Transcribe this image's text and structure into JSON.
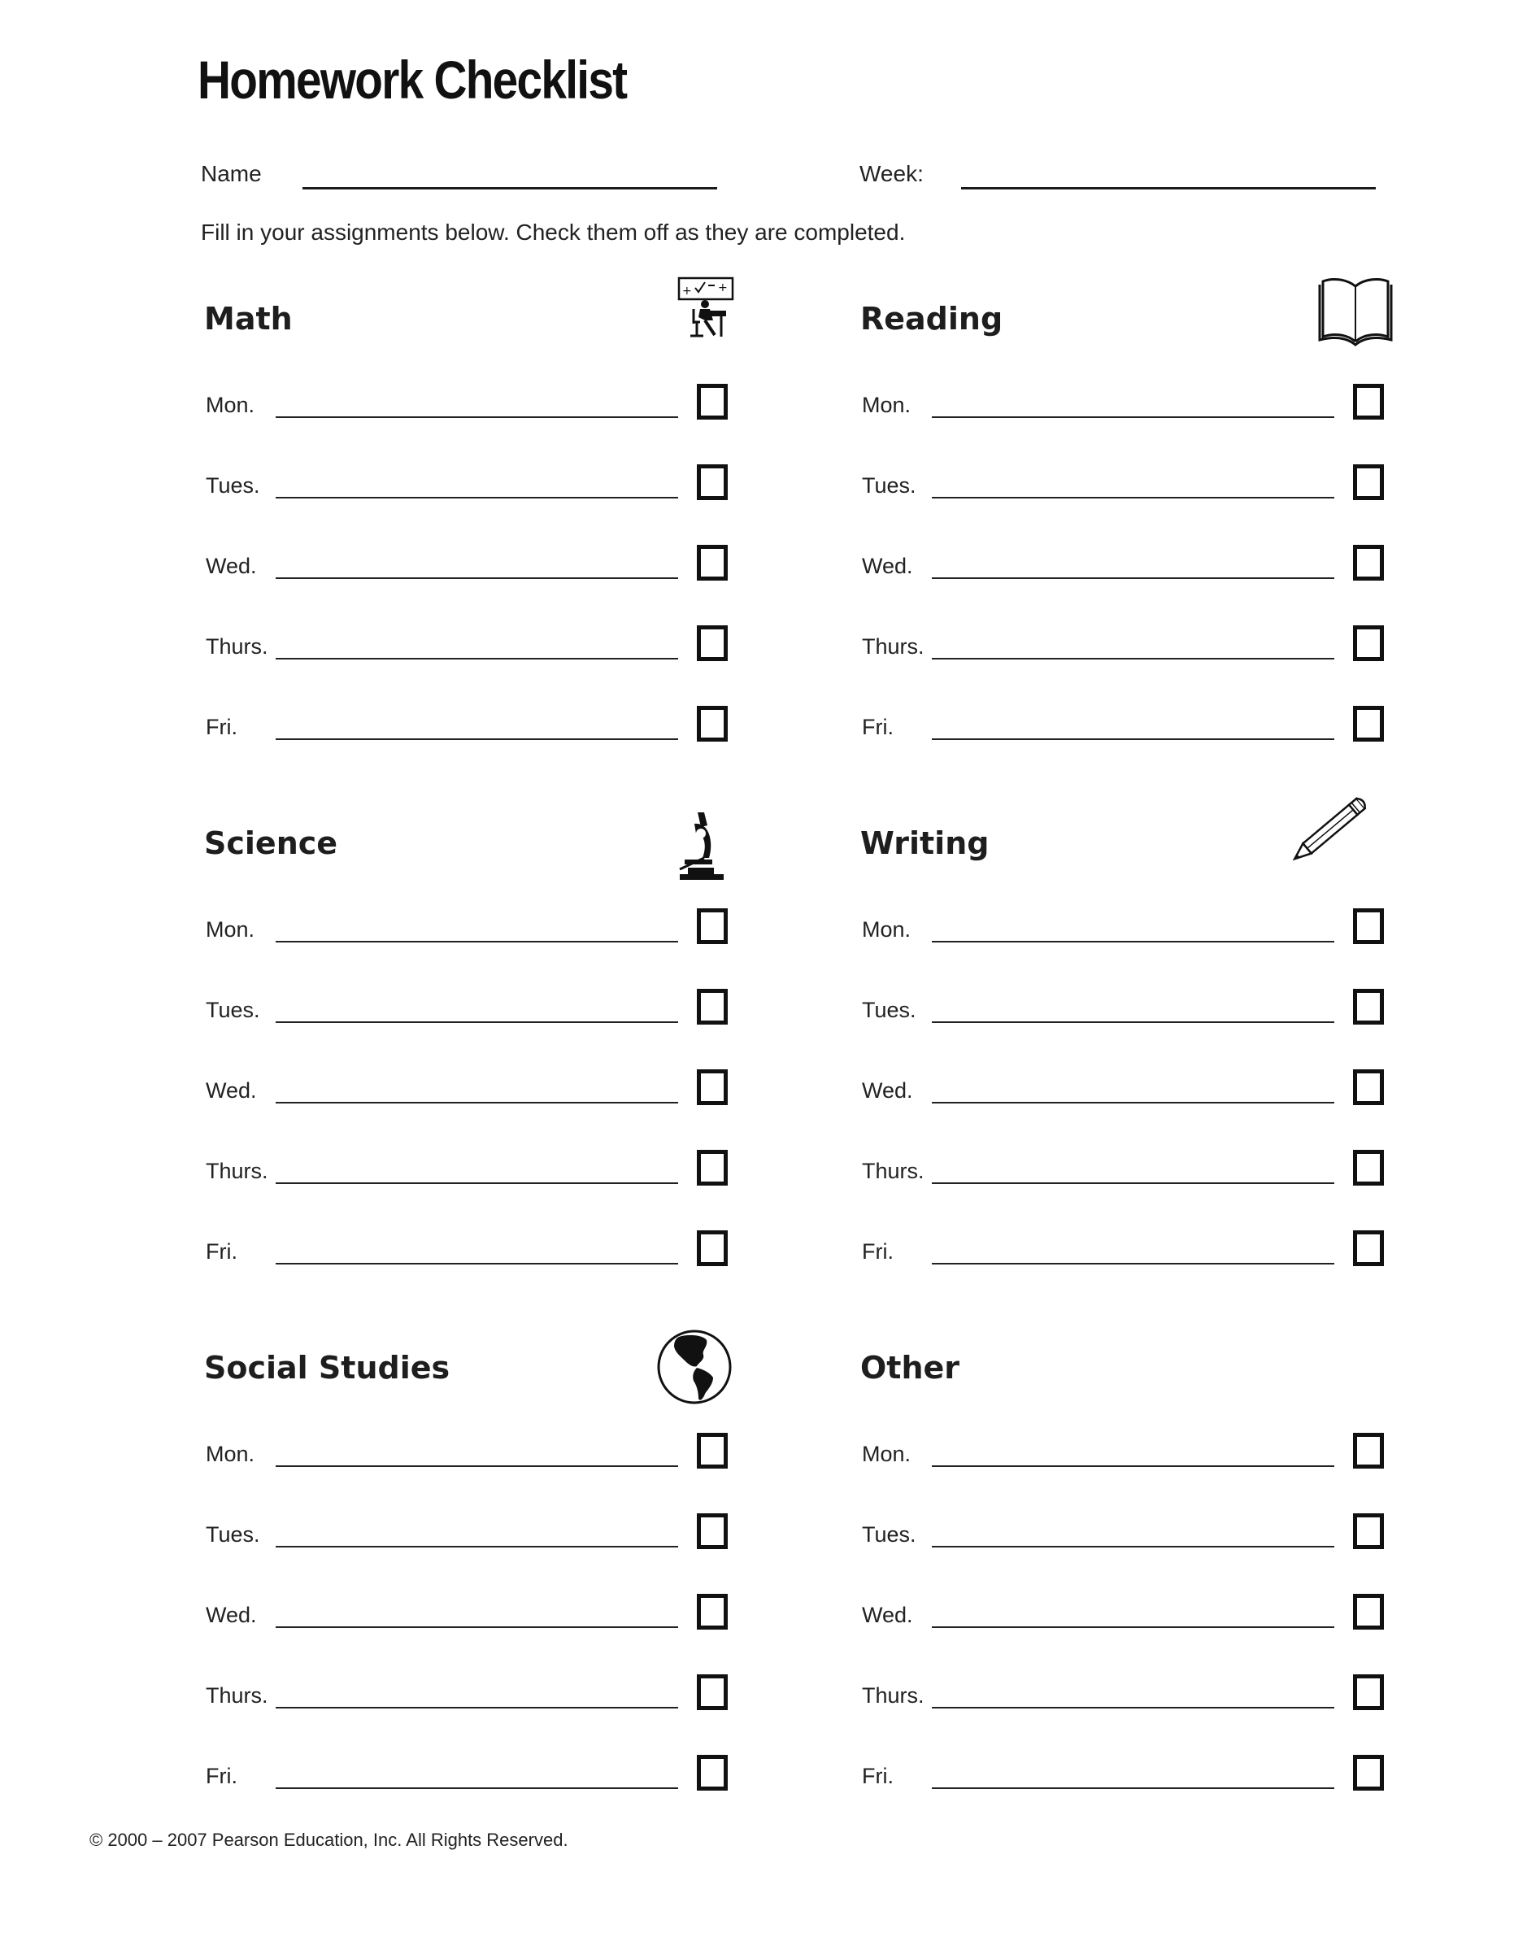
{
  "title": "Homework Checklist",
  "fields": {
    "name_label": "Name",
    "name_value": "",
    "week_label": "Week:",
    "week_value": ""
  },
  "instructions": "Fill in your assignments below. Check them off as they are completed.",
  "sections": [
    {
      "title": "Math",
      "icon": "math-student-icon",
      "rows": [
        {
          "day": "Mon.",
          "value": "",
          "checked": false
        },
        {
          "day": "Tues.",
          "value": "",
          "checked": false
        },
        {
          "day": "Wed.",
          "value": "",
          "checked": false
        },
        {
          "day": "Thurs.",
          "value": "",
          "checked": false
        },
        {
          "day": "Fri.",
          "value": "",
          "checked": false
        }
      ]
    },
    {
      "title": "Reading",
      "icon": "open-book-icon",
      "rows": [
        {
          "day": "Mon.",
          "value": "",
          "checked": false
        },
        {
          "day": "Tues.",
          "value": "",
          "checked": false
        },
        {
          "day": "Wed.",
          "value": "",
          "checked": false
        },
        {
          "day": "Thurs.",
          "value": "",
          "checked": false
        },
        {
          "day": "Fri.",
          "value": "",
          "checked": false
        }
      ]
    },
    {
      "title": "Science",
      "icon": "microscope-icon",
      "rows": [
        {
          "day": "Mon.",
          "value": "",
          "checked": false
        },
        {
          "day": "Tues.",
          "value": "",
          "checked": false
        },
        {
          "day": "Wed.",
          "value": "",
          "checked": false
        },
        {
          "day": "Thurs.",
          "value": "",
          "checked": false
        },
        {
          "day": "Fri.",
          "value": "",
          "checked": false
        }
      ]
    },
    {
      "title": "Writing",
      "icon": "pencil-icon",
      "rows": [
        {
          "day": "Mon.",
          "value": "",
          "checked": false
        },
        {
          "day": "Tues.",
          "value": "",
          "checked": false
        },
        {
          "day": "Wed.",
          "value": "",
          "checked": false
        },
        {
          "day": "Thurs.",
          "value": "",
          "checked": false
        },
        {
          "day": "Fri.",
          "value": "",
          "checked": false
        }
      ]
    },
    {
      "title": "Social Studies",
      "icon": "globe-icon",
      "rows": [
        {
          "day": "Mon.",
          "value": "",
          "checked": false
        },
        {
          "day": "Tues.",
          "value": "",
          "checked": false
        },
        {
          "day": "Wed.",
          "value": "",
          "checked": false
        },
        {
          "day": "Thurs.",
          "value": "",
          "checked": false
        },
        {
          "day": "Fri.",
          "value": "",
          "checked": false
        }
      ]
    },
    {
      "title": "Other",
      "icon": "",
      "rows": [
        {
          "day": "Mon.",
          "value": "",
          "checked": false
        },
        {
          "day": "Tues.",
          "value": "",
          "checked": false
        },
        {
          "day": "Wed.",
          "value": "",
          "checked": false
        },
        {
          "day": "Thurs.",
          "value": "",
          "checked": false
        },
        {
          "day": "Fri.",
          "value": "",
          "checked": false
        }
      ]
    }
  ],
  "footer": "© 2000 – 2007 Pearson Education, Inc. All Rights Reserved."
}
